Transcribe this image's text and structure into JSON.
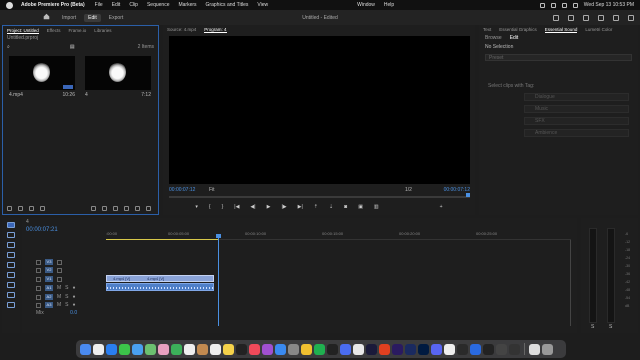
{
  "menubar": {
    "app": "Adobe Premiere Pro (Beta)",
    "items": [
      "File",
      "Edit",
      "Clip",
      "Sequence",
      "Markers",
      "Graphics and Titles",
      "View",
      "Window",
      "Help"
    ],
    "clock": "Wed Sep 13  10:53 PM"
  },
  "header": {
    "tabs": [
      "Import",
      "Edit",
      "Export"
    ],
    "active_tab": "Edit",
    "title": "Untitled - Edited"
  },
  "project": {
    "tabs": [
      "Project: Untitled",
      "Effects",
      "Frame.io",
      "Libraries"
    ],
    "path": "Untitled.prproj",
    "items_count": "2 Items",
    "clips": [
      {
        "name": "4.mp4",
        "duration": "10:26"
      },
      {
        "name": "4",
        "duration": "7:12"
      }
    ]
  },
  "monitor": {
    "tabs": [
      "Source: 4.mp4",
      "Program: 4"
    ],
    "timecode_left": "00:00:07:12",
    "fit": "Fit",
    "fraction": "1/2",
    "timecode_right": "00:00:07:12"
  },
  "essential": {
    "tabs": [
      "Text",
      "Essential Graphics",
      "Essential Sound",
      "Lumetri Color"
    ],
    "subtabs": [
      "Browse",
      "Edit"
    ],
    "no_selection": "No Selection",
    "preset": "Preset",
    "hint": "Select clips with Tag:",
    "tags": [
      "Dialogue",
      "Music",
      "SFX",
      "Ambience"
    ]
  },
  "timeline": {
    "tab": "4",
    "timecode": "00:00:07:21",
    "ruler": [
      ":00:00",
      "00:00:05:00",
      "00:00:10:00",
      "00:00:15:00",
      "00:00:20:00",
      "00:00:25:00"
    ],
    "video_tracks": [
      "V3",
      "V2",
      "V1"
    ],
    "audio_tracks": [
      "A1",
      "A2",
      "A3"
    ],
    "clip_labels": [
      "4.mp4 [V]",
      "4.mp4 [V]"
    ],
    "mix_label": "Mix",
    "mix_value": "0.0"
  },
  "meters": {
    "scale": [
      "-6",
      "-12",
      "-18",
      "-24",
      "-30",
      "-36",
      "-42",
      "-48",
      "-54",
      "dB"
    ],
    "left": "S",
    "right": "S"
  }
}
